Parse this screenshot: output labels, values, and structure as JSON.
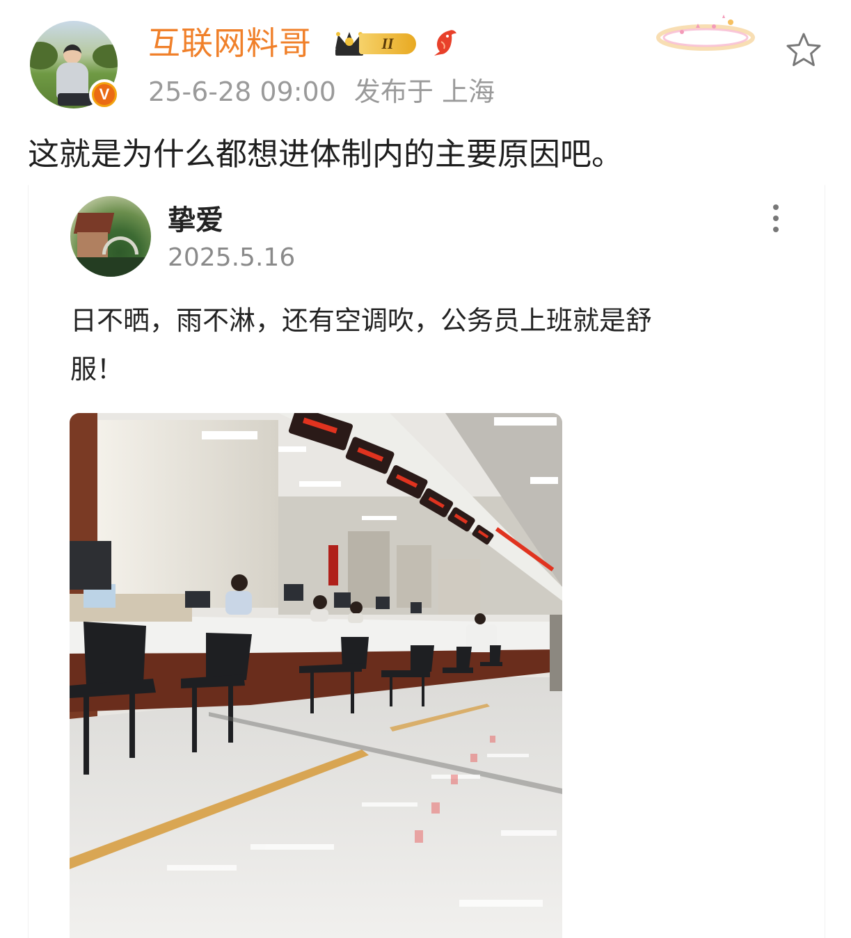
{
  "post": {
    "author": "互联网料哥",
    "vip_level": "II",
    "timestamp": "25-6-28 09:00",
    "location": "发布于 上海",
    "verified_mark": "V",
    "text": "这就是为什么都想进体制内的主要原因吧。"
  },
  "repost": {
    "author": "挚爱",
    "date": "2025.5.16",
    "text": "日不晒，雨不淋，还有空调吹，公务员上班就是舒\n服！"
  },
  "icons": {
    "favorite": "star-outline-icon",
    "more": "more-vertical-icon",
    "vip": "crown-icon",
    "decoration": "koi-fish-icon"
  },
  "colors": {
    "username": "#f0802a",
    "muted": "#9a9a9a",
    "verified": "#f2a30f"
  }
}
